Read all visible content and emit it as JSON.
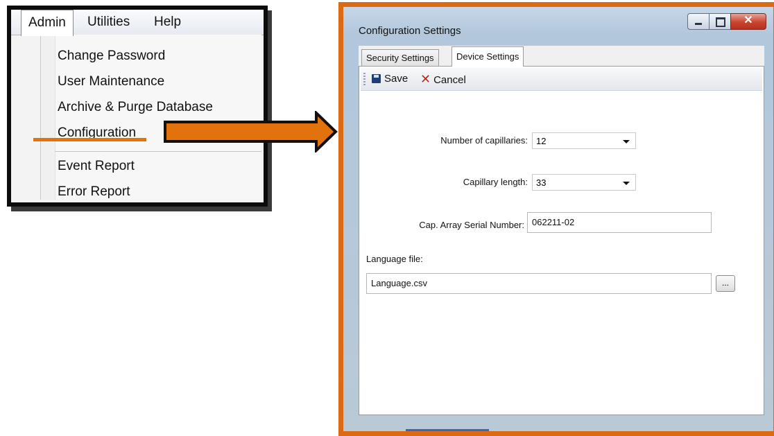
{
  "menu": {
    "menubar": [
      "Admin",
      "Utilities",
      "Help"
    ],
    "items_group1": [
      "Change Password",
      "User Maintenance",
      "Archive & Purge Database",
      "Configuration"
    ],
    "items_group2": [
      "Event Report",
      "Error Report"
    ],
    "highlight_color": "#e2720c"
  },
  "window": {
    "title": "Configuration Settings",
    "frame_color": "#dc6a12",
    "tabs": [
      "Security Settings",
      "Device Settings"
    ],
    "selected_tab": "Device Settings",
    "toolbar": {
      "save_label": "Save",
      "cancel_label": "Cancel"
    },
    "fields": {
      "capillaries_label": "Number of capillaries:",
      "capillaries_value": "12",
      "length_label": "Capillary length:",
      "length_value": "33",
      "serial_label": "Cap. Array Serial Number:",
      "serial_value": "062211-02",
      "language_label": "Language file:",
      "language_value": "Language.csv",
      "browse_label": "..."
    }
  }
}
